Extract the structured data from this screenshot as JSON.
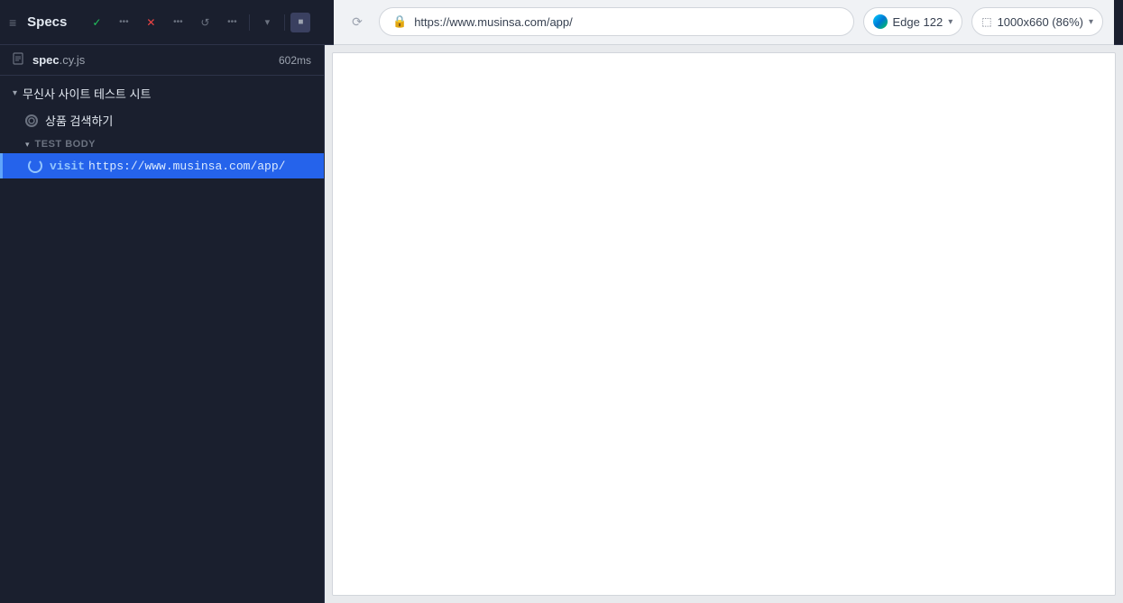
{
  "app": {
    "title": "Specs"
  },
  "toolbar": {
    "hamburger": "≡",
    "check_icon": "✓",
    "dots1": "•••",
    "close_icon": "✕",
    "dots2": "•••",
    "reload_icon": "↺",
    "dots3": "•••",
    "dropdown_icon": "▾",
    "square_icon": "■"
  },
  "browser_bar": {
    "nav_icon": "⟳",
    "url": "https://www.musinsa.com/app/",
    "edge_label": "Edge 122",
    "viewport_label": "1000x660 (86%)"
  },
  "spec_file": {
    "icon": "📄",
    "name_bold": "spec",
    "name_ext": ".cy.js",
    "time": "602ms"
  },
  "test_suite": {
    "chevron": "▾",
    "label": "무신사 사이트 테스트 시트"
  },
  "test_case": {
    "label": "상품 검색하기"
  },
  "test_body": {
    "chevron": "▾",
    "label": "TEST BODY"
  },
  "command": {
    "keyword": "visit",
    "url": "https://www.musinsa.com/app/"
  },
  "colors": {
    "sidebar_bg": "#1a1f2e",
    "command_bg": "#2563eb",
    "accent_blue": "#60a5fa"
  }
}
